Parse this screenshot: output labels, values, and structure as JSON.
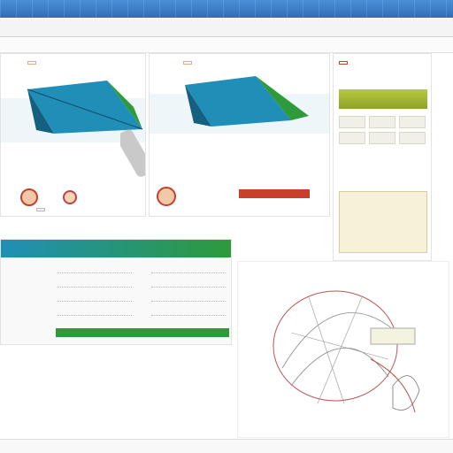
{
  "menu": {
    "items": []
  },
  "panels": {
    "left_card": {
      "title": "",
      "caption": "",
      "button": ""
    },
    "middle_card": {
      "title": "",
      "caption": "",
      "button": ""
    },
    "right_card": {
      "title": "",
      "stats": []
    },
    "table": {
      "col1": [],
      "col2": [],
      "caption1": "",
      "caption2": "",
      "caption3": ""
    },
    "drawing": {
      "caption": ""
    }
  },
  "colors": {
    "tent_teal": "#1f8fb8",
    "tent_dark": "#14607e",
    "accent_green": "#2e9a3a",
    "accent_orange": "#e0b070",
    "accent_red": "#c8402a"
  }
}
